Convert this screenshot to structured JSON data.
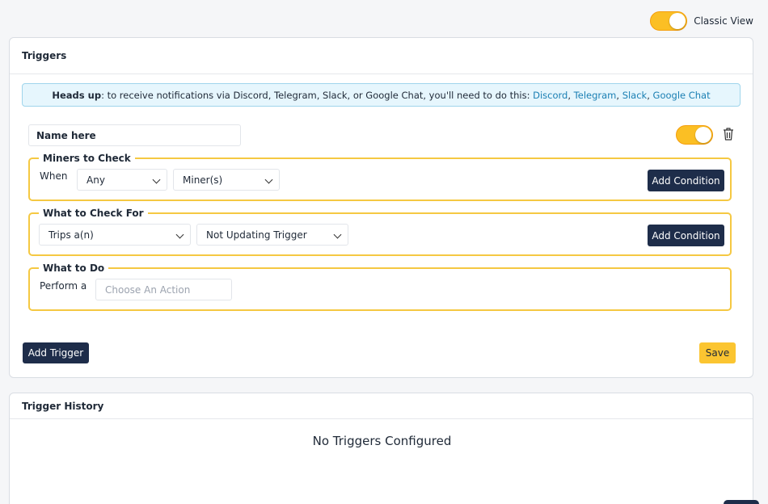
{
  "top": {
    "classic_view_label": "Classic View",
    "classic_view_on": true
  },
  "triggers_card": {
    "title": "Triggers",
    "alert": {
      "heads_up": "Heads up",
      "message": ": to receive notifications via Discord, Telegram, Slack, or Google Chat, you'll need to do this: ",
      "links": [
        "Discord",
        "Telegram",
        "Slack",
        "Google Chat"
      ],
      "separator": ", "
    },
    "trigger": {
      "name_value": "Name here",
      "enabled": true,
      "miners_group": {
        "legend": "Miners to Check",
        "when_label": "When",
        "quantifier": "Any",
        "target": "Miner(s)",
        "add_condition": "Add Condition"
      },
      "check_group": {
        "legend": "What to Check For",
        "trips": "Trips a(n)",
        "trigger_type": "Not Updating Trigger",
        "add_condition": "Add Condition"
      },
      "action_group": {
        "legend": "What to Do",
        "perform_label": "Perform a",
        "action_placeholder": "Choose An Action"
      }
    },
    "add_trigger": "Add Trigger",
    "save": "Save"
  },
  "history_card": {
    "title": "Trigger History",
    "empty_text": "No Triggers Configured"
  },
  "colors": {
    "accent": "#fbc531",
    "dark_button": "#1e2d4a",
    "link": "#1a7fb3",
    "group_border": "#f5c842"
  }
}
